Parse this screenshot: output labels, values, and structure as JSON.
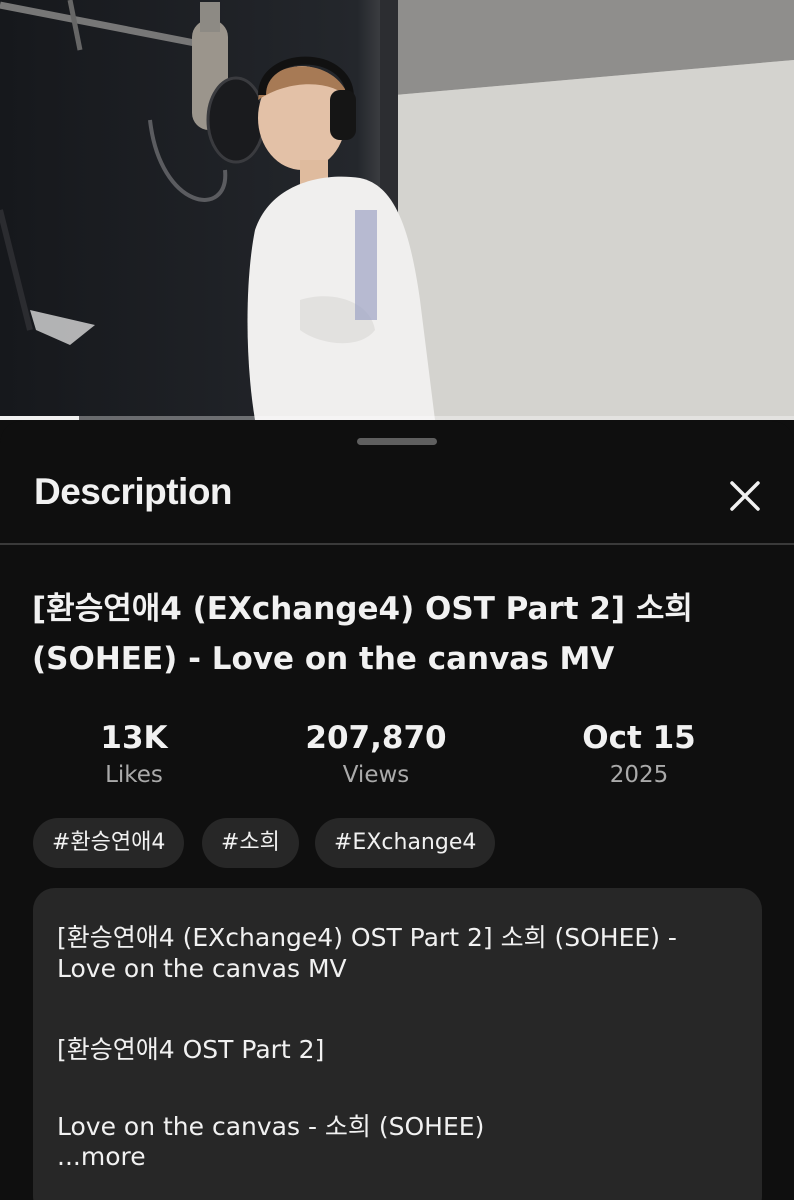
{
  "video": {
    "progress_fraction": 0.1
  },
  "sheet": {
    "title": "Description",
    "close_icon": "close-icon"
  },
  "video_title": "[환승연애4 (EXchange4) OST Part 2] 소희 (SOHEE) - Love on the canvas MV",
  "stats": {
    "likes": {
      "value": "13K",
      "label": "Likes"
    },
    "views": {
      "value": "207,870",
      "label": "Views"
    },
    "date": {
      "value": "Oct 15",
      "label": "2025"
    }
  },
  "tags": [
    "#환승연애4",
    "#소희",
    "#EXchange4"
  ],
  "description": {
    "lines": [
      "[환승연애4 (EXchange4) OST Part 2] 소희 (SOHEE) -",
      "Love on the canvas MV",
      "[환승연애4 OST Part 2]",
      "Love on the canvas - 소희 (SOHEE)"
    ],
    "more_label": "...more"
  },
  "colors": {
    "background": "#0f0f0f",
    "chip": "#272727",
    "secondary_text": "#aaaaaa"
  }
}
